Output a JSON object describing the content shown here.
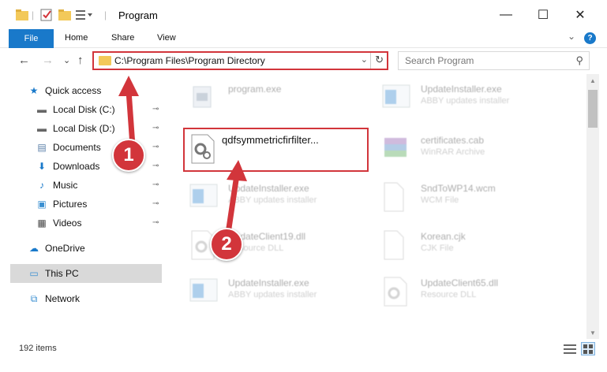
{
  "window": {
    "title": "Program",
    "minimize": "—",
    "maximize": "☐",
    "close": "✕"
  },
  "ribbon": {
    "tabs": [
      "File",
      "Home",
      "Share",
      "View"
    ],
    "collapse": "⌄",
    "help": "?"
  },
  "nav": {
    "back": "←",
    "forward": "→",
    "recent": "⌄",
    "up": "↑",
    "address": "C:\\Program Files\\Program Directory",
    "address_dropdown": "⌄",
    "refresh": "↻",
    "search_placeholder": "Search Program",
    "search_icon": "⚲"
  },
  "sidebar": {
    "items": [
      {
        "label": "Quick access",
        "icon": "star-icon",
        "glyph": "★",
        "color": "#1979ca",
        "pinned": false
      },
      {
        "label": "Local Disk (C:)",
        "icon": "drive-icon",
        "glyph": "▬",
        "color": "#666666",
        "pinned": true
      },
      {
        "label": "Local Disk (D:)",
        "icon": "drive-icon",
        "glyph": "▬",
        "color": "#666666",
        "pinned": true
      },
      {
        "label": "Documents",
        "icon": "documents-icon",
        "glyph": "▤",
        "color": "#5a7fa8",
        "pinned": true
      },
      {
        "label": "Downloads",
        "icon": "downloads-icon",
        "glyph": "⬇",
        "color": "#1979ca",
        "pinned": true
      },
      {
        "label": "Music",
        "icon": "music-icon",
        "glyph": "♪",
        "color": "#1979ca",
        "pinned": true
      },
      {
        "label": "Pictures",
        "icon": "pictures-icon",
        "glyph": "▣",
        "color": "#3a8fd1",
        "pinned": true
      },
      {
        "label": "Videos",
        "icon": "videos-icon",
        "glyph": "▦",
        "color": "#444444",
        "pinned": true
      },
      {
        "label": "OneDrive",
        "icon": "cloud-icon",
        "glyph": "☁",
        "color": "#1979ca",
        "pinned": false
      },
      {
        "label": "This PC",
        "icon": "computer-icon",
        "glyph": "▭",
        "color": "#3a8fd1",
        "pinned": false
      },
      {
        "label": "Network",
        "icon": "network-icon",
        "glyph": "⧉",
        "color": "#3a8fd1",
        "pinned": false
      }
    ],
    "pin_glyph": "📌"
  },
  "files": [
    {
      "name": "program.exe",
      "desc": "",
      "icon": "exe-icon"
    },
    {
      "name": "UpdateInstaller.exe",
      "desc": "ABBY updates installer",
      "icon": "installer-icon"
    },
    {
      "name": "qdfsymmetricfirfilter...",
      "desc": "",
      "icon": "dll-gear-icon"
    },
    {
      "name": "certificates.cab",
      "desc": "WinRAR Archive",
      "icon": "archive-icon"
    },
    {
      "name": "UpdateInstaller.exe",
      "desc": "ABBY updates installer",
      "icon": "installer-icon"
    },
    {
      "name": "SndToWP14.wcm",
      "desc": "WCM File",
      "icon": "blank-file-icon"
    },
    {
      "name": "UpdateClient19.dll",
      "desc": "Resource DLL",
      "icon": "dll-icon"
    },
    {
      "name": "Korean.cjk",
      "desc": "CJK File",
      "icon": "blank-file-icon"
    },
    {
      "name": "UpdateInstaller.exe",
      "desc": "ABBY updates installer",
      "icon": "installer-icon"
    },
    {
      "name": "UpdateClient65.dll",
      "desc": "Resource DLL",
      "icon": "dll-icon"
    }
  ],
  "status": {
    "item_count": "192 items"
  },
  "annotations": {
    "step1": "1",
    "step2": "2",
    "color": "#d2353b"
  }
}
